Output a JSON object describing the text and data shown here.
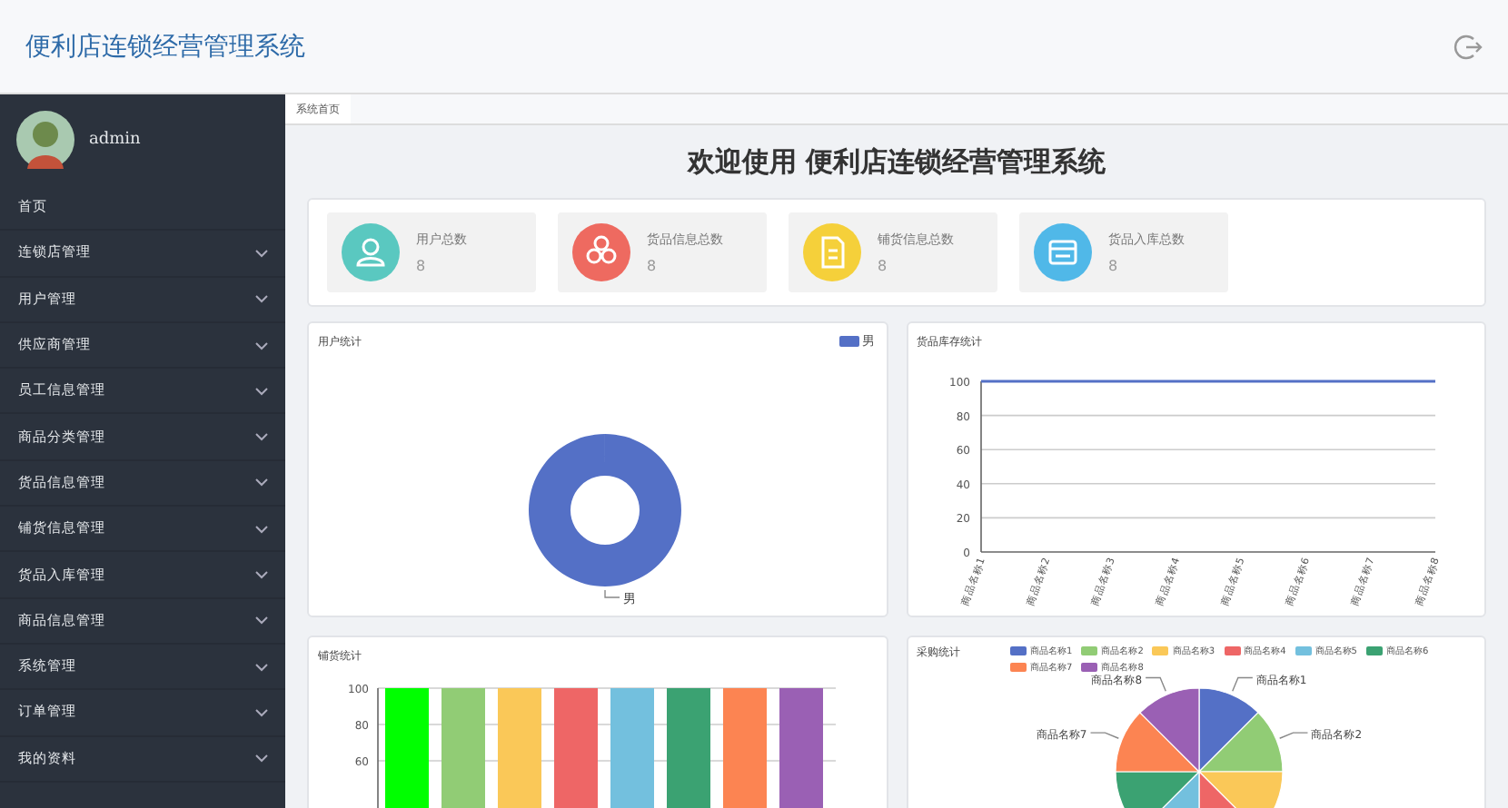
{
  "header": {
    "title": "便利店连锁经营管理系统"
  },
  "sidebar": {
    "user": "admin",
    "items": [
      {
        "label": "首页",
        "kind": "link"
      },
      {
        "label": "连锁店管理",
        "kind": "submenu"
      },
      {
        "label": "用户管理",
        "kind": "submenu"
      },
      {
        "label": "供应商管理",
        "kind": "submenu"
      },
      {
        "label": "员工信息管理",
        "kind": "submenu"
      },
      {
        "label": "商品分类管理",
        "kind": "submenu"
      },
      {
        "label": "货品信息管理",
        "kind": "submenu"
      },
      {
        "label": "铺货信息管理",
        "kind": "submenu"
      },
      {
        "label": "货品入库管理",
        "kind": "submenu"
      },
      {
        "label": "商品信息管理",
        "kind": "submenu"
      },
      {
        "label": "系统管理",
        "kind": "submenu"
      },
      {
        "label": "订单管理",
        "kind": "submenu"
      },
      {
        "label": "我的资料",
        "kind": "submenu"
      }
    ]
  },
  "tabs": [
    {
      "label": "系统首页",
      "selected": true
    }
  ],
  "welcome": "欢迎使用 便利店连锁经营管理系统",
  "stats": [
    {
      "label": "用户总数",
      "value": "8",
      "kind": "user",
      "color": "#5ac8c0"
    },
    {
      "label": "货品信息总数",
      "value": "8",
      "kind": "goods",
      "color": "#ee6a60"
    },
    {
      "label": "铺货信息总数",
      "value": "8",
      "kind": "document",
      "color": "#f5d03a"
    },
    {
      "label": "货品入库总数",
      "value": "8",
      "kind": "card",
      "color": "#50b8e8"
    }
  ],
  "charts": [
    {
      "title": "用户统计",
      "chart_data": {
        "type": "pie",
        "categories": [
          "男"
        ],
        "values": [
          100
        ],
        "colors": [
          "#5470c6"
        ]
      }
    },
    {
      "title": "货品库存统计",
      "chart_data": {
        "type": "line",
        "categories": [
          "商品名称1",
          "商品名称2",
          "商品名称3",
          "商品名称4",
          "商品名称5",
          "商品名称6",
          "商品名称7",
          "商品名称8"
        ],
        "yticks": [
          0,
          20,
          40,
          60,
          80,
          100
        ],
        "ylim": [
          0,
          100
        ],
        "grid": true,
        "values": [
          100,
          100,
          100,
          100,
          100,
          100,
          100,
          100
        ],
        "color": "#5470c6"
      }
    },
    {
      "title": "铺货统计",
      "chart_data": {
        "type": "bar",
        "yticks": [
          60,
          80,
          100
        ],
        "ylim": [
          0,
          100
        ],
        "grid": true,
        "values": [
          100,
          100,
          100,
          100,
          100,
          100,
          100,
          100
        ],
        "colors": [
          "#00ff00",
          "#91cc75",
          "#fac858",
          "#ee6666",
          "#73c0de",
          "#3ba272",
          "#fc8452",
          "#9a60b4"
        ]
      }
    },
    {
      "title": "采购统计",
      "chart_data": {
        "type": "pie",
        "categories": [
          "商品名称1",
          "商品名称2",
          "商品名称3",
          "商品名称4",
          "商品名称5",
          "商品名称6",
          "商品名称7",
          "商品名称8"
        ],
        "values": [
          12.5,
          12.5,
          12.5,
          12.5,
          12.5,
          12.5,
          12.5,
          12.5
        ],
        "colors": [
          "#5470c6",
          "#91cc75",
          "#fac858",
          "#ee6666",
          "#73c0de",
          "#3ba272",
          "#fc8452",
          "#9a60b4"
        ]
      }
    }
  ]
}
